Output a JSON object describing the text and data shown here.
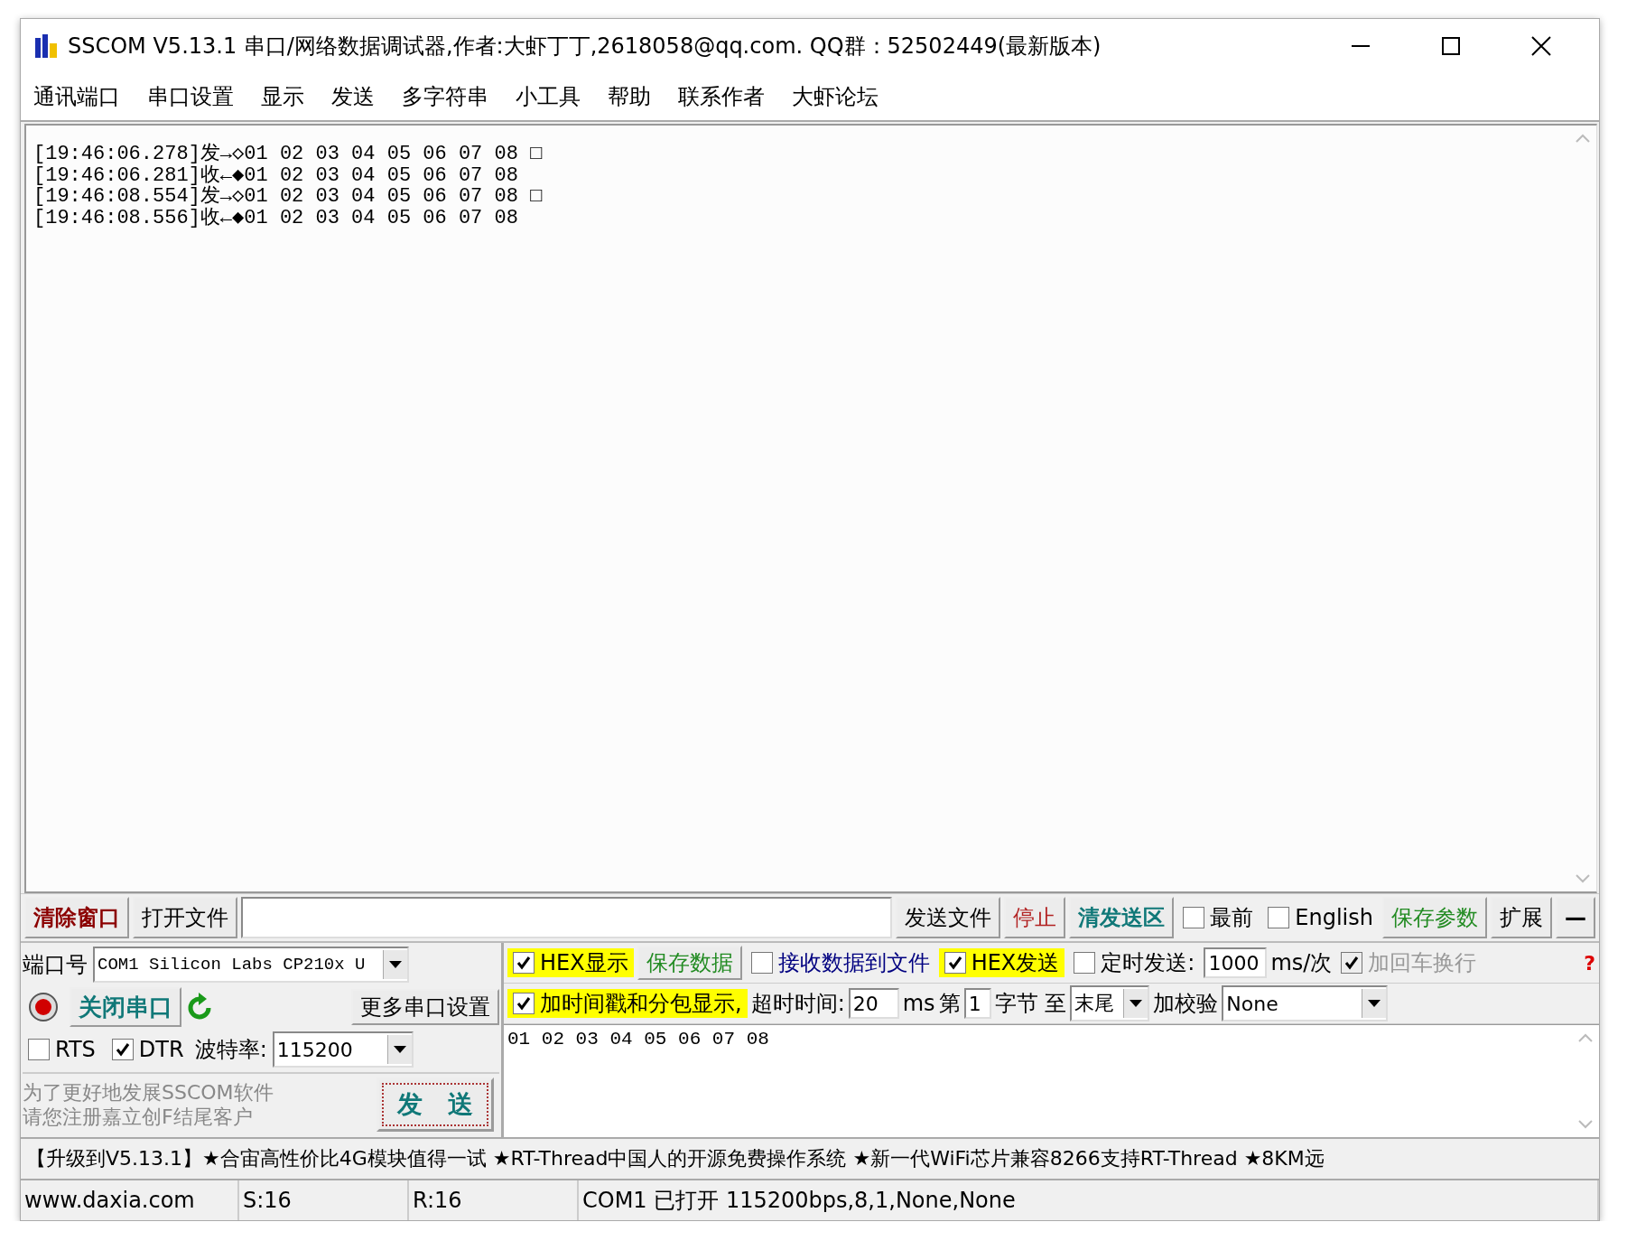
{
  "window": {
    "title": "SSCOM V5.13.1 串口/网络数据调试器,作者:大虾丁丁,2618058@qq.com. QQ群：52502449(最新版本)"
  },
  "menu": [
    "通讯端口",
    "串口设置",
    "显示",
    "发送",
    "多字符串",
    "小工具",
    "帮助",
    "联系作者",
    "大虾论坛"
  ],
  "receive": {
    "lines": [
      "[19:46:06.278]发→◇01 02 03 04 05 06 07 08 □",
      "[19:46:06.281]收←◆01 02 03 04 05 06 07 08",
      "[19:46:08.554]发→◇01 02 03 04 05 06 07 08 □",
      "[19:46:08.556]收←◆01 02 03 04 05 06 07 08"
    ]
  },
  "toolbar": [
    {
      "kind": "button",
      "label": "清除窗口",
      "color": "#8b0000",
      "bold": true
    },
    {
      "kind": "button",
      "label": "打开文件",
      "color": "#000000",
      "bold": false
    },
    {
      "kind": "field"
    },
    {
      "kind": "button",
      "label": "发送文件",
      "color": "#000000",
      "bold": false
    },
    {
      "kind": "button",
      "label": "停止",
      "color": "#b22222",
      "bold": false
    },
    {
      "kind": "button",
      "label": "清发送区",
      "color": "#107878",
      "bold": true
    },
    {
      "kind": "checkbox",
      "label": "最前",
      "checked": false
    },
    {
      "kind": "checkbox",
      "label": "English",
      "checked": false
    },
    {
      "kind": "button",
      "label": "保存参数",
      "color": "#228b22",
      "bold": false
    },
    {
      "kind": "button",
      "label": "扩展",
      "color": "#000000",
      "bold": false
    },
    {
      "kind": "button",
      "label": "—",
      "color": "#000000",
      "bold": true
    }
  ],
  "port": {
    "label": "端口号",
    "value": "COM1 Silicon Labs CP210x U",
    "open_button": "关闭串口",
    "more_button": "更多串口设置",
    "rts": {
      "label": "RTS",
      "checked": false
    },
    "dtr": {
      "label": "DTR",
      "checked": true
    },
    "baud_label": "波特率:",
    "baud": "115200",
    "promo": [
      "为了更好地发展SSCOM软件",
      "请您注册嘉立创F结尾客户"
    ],
    "send_button": "发　送"
  },
  "options": [
    {
      "items": [
        {
          "kind": "checkbox",
          "label": "HEX显示",
          "checked": true,
          "highlight": true
        },
        {
          "kind": "button",
          "label": "保存数据",
          "color": "#228b22"
        },
        {
          "kind": "checkbox",
          "label": "接收数据到文件",
          "checked": false,
          "highlight": false,
          "color": "#000080"
        },
        {
          "kind": "checkbox",
          "label": "HEX发送",
          "checked": true,
          "highlight": true
        },
        {
          "kind": "checkbox",
          "label": "定时发送:",
          "checked": false,
          "highlight": false
        },
        {
          "kind": "field",
          "value": "1000"
        },
        {
          "kind": "text",
          "label": "ms/次"
        },
        {
          "kind": "checkbox",
          "label": "加回车换行",
          "checked": true,
          "highlight": false,
          "disabled": true
        }
      ]
    },
    {
      "items": [
        {
          "kind": "checkbox",
          "label": "加时间戳和分包显示,",
          "checked": true,
          "highlight": true
        },
        {
          "kind": "text",
          "label": "超时时间:"
        },
        {
          "kind": "field",
          "value": "20"
        },
        {
          "kind": "text",
          "label": "ms"
        },
        {
          "kind": "text",
          "label": "第"
        },
        {
          "kind": "field",
          "value": "1"
        },
        {
          "kind": "text",
          "label": "字节 至"
        },
        {
          "kind": "combo",
          "value": "末尾"
        },
        {
          "kind": "text",
          "label": "加校验"
        },
        {
          "kind": "combo",
          "value": "None",
          "wide": true
        }
      ]
    }
  ],
  "help": "?",
  "send": {
    "value": "01 02 03 04 05 06 07 08"
  },
  "ticker": "【升级到V5.13.1】★合宙高性价比4G模块值得一试 ★RT-Thread中国人的开源免费操作系统 ★新一代WiFi芯片兼容8266支持RT-Thread ★8KM远",
  "status": [
    "www.daxia.com",
    "S:16",
    "R:16",
    "COM1 已打开  115200bps,8,1,None,None"
  ]
}
